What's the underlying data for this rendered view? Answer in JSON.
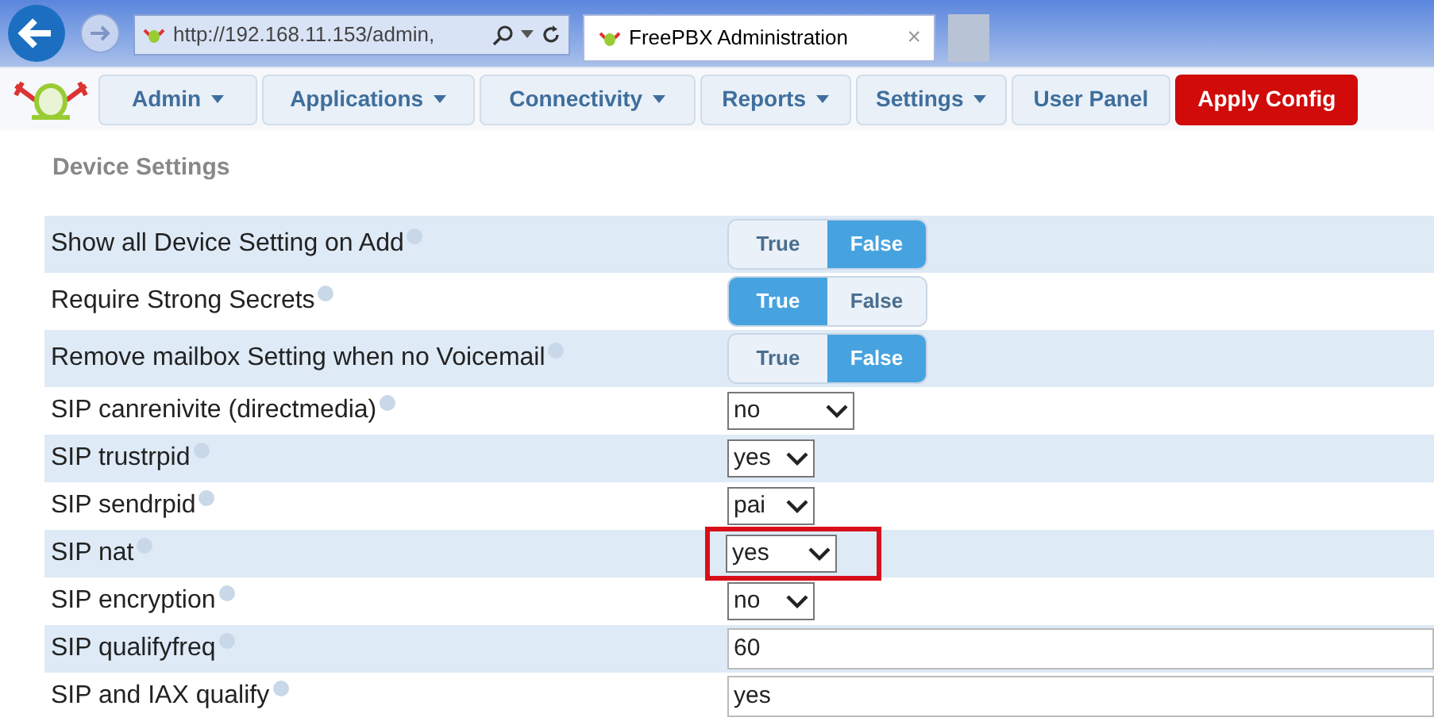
{
  "browser": {
    "address": "http://192.168.11.153/admin,",
    "tab_title": "FreePBX Administration",
    "tab_close": "×"
  },
  "nav": [
    {
      "label": "Admin",
      "kind": "menu"
    },
    {
      "label": "Applications",
      "kind": "menu"
    },
    {
      "label": "Connectivity",
      "kind": "menu"
    },
    {
      "label": "Reports",
      "kind": "menu"
    },
    {
      "label": "Settings",
      "kind": "menu"
    },
    {
      "label": "User Panel",
      "kind": "link"
    },
    {
      "label": "Apply Config",
      "kind": "apply"
    }
  ],
  "heading": "Device Settings",
  "settings": [
    {
      "label": "Show all Device Setting on Add",
      "kind": "toggle",
      "options": [
        {
          "label": "True",
          "selected": false
        },
        {
          "label": "False",
          "selected": true
        }
      ]
    },
    {
      "label": "Require Strong Secrets",
      "kind": "toggle",
      "options": [
        {
          "label": "True",
          "selected": true
        },
        {
          "label": "False",
          "selected": false
        }
      ]
    },
    {
      "label": "Remove mailbox Setting when no Voicemail",
      "kind": "toggle",
      "options": [
        {
          "label": "True",
          "selected": false
        },
        {
          "label": "False",
          "selected": true
        }
      ]
    },
    {
      "label": "SIP canrenivite (directmedia)",
      "kind": "select",
      "value": "no",
      "highlighted": false
    },
    {
      "label": "SIP trustrpid",
      "kind": "select",
      "value": "yes",
      "highlighted": false
    },
    {
      "label": "SIP sendrpid",
      "kind": "select",
      "value": "pai",
      "highlighted": false
    },
    {
      "label": "SIP nat",
      "kind": "select",
      "value": "yes",
      "highlighted": true
    },
    {
      "label": "SIP encryption",
      "kind": "select",
      "value": "no",
      "highlighted": false
    },
    {
      "label": "SIP qualifyfreq",
      "kind": "text",
      "value": "60"
    },
    {
      "label": "SIP and IAX qualify",
      "kind": "text",
      "value": "yes"
    }
  ]
}
